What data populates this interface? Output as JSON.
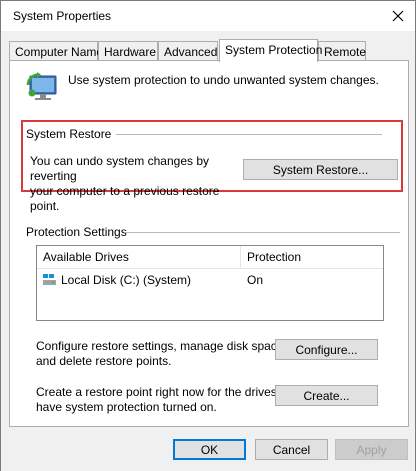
{
  "window": {
    "title": "System Properties"
  },
  "tabs": [
    {
      "label": "Computer Name"
    },
    {
      "label": "Hardware"
    },
    {
      "label": "Advanced"
    },
    {
      "label": "System Protection"
    },
    {
      "label": "Remote"
    }
  ],
  "intro": {
    "text": "Use system protection to undo unwanted system changes.",
    "icon": "system-protection-icon"
  },
  "system_restore": {
    "group_label": "System Restore",
    "description_line1": "You can undo system changes by reverting",
    "description_line2": "your computer to a previous restore point.",
    "button_label": "System Restore...",
    "highlight_color": "#d63a3a"
  },
  "protection_settings": {
    "group_label": "Protection Settings",
    "columns": [
      "Available Drives",
      "Protection"
    ],
    "drives": [
      {
        "name": "Local Disk (C:) (System)",
        "protection": "On",
        "icon": "drive-icon"
      }
    ]
  },
  "configure": {
    "line1": "Configure restore settings, manage disk space,",
    "line2": "and delete restore points.",
    "button_label": "Configure..."
  },
  "create": {
    "line1": "Create a restore point right now for the drives that",
    "line2": "have system protection turned on.",
    "button_label": "Create..."
  },
  "footer": {
    "ok_label": "OK",
    "cancel_label": "Cancel",
    "apply_label": "Apply"
  },
  "colors": {
    "default_button_border": "#0078d7",
    "window_background": "#f0f0f0"
  }
}
